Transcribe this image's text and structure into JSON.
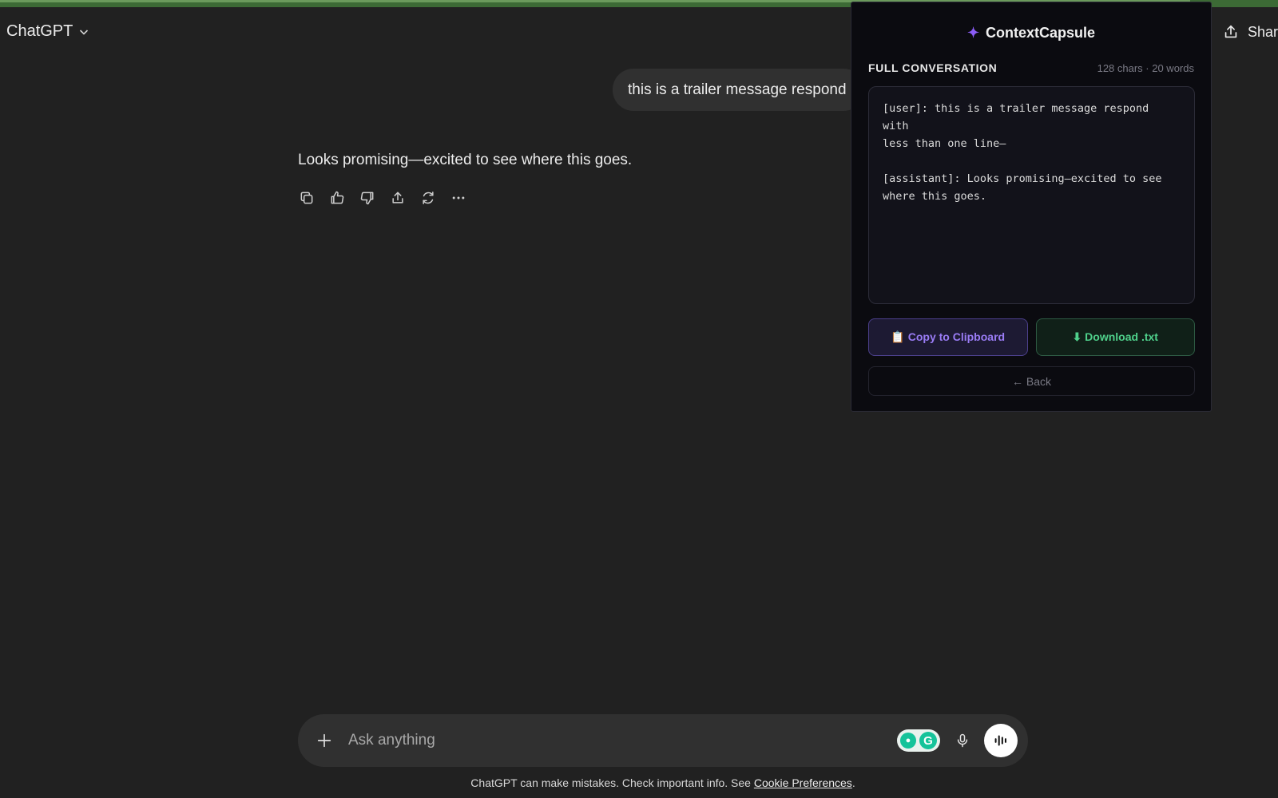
{
  "header": {
    "model_label": "ChatGPT",
    "share_label": "Share"
  },
  "conversation": {
    "user_message": "this is a trailer message respond",
    "assistant_message": "Looks promising—excited to see where this goes."
  },
  "capsule": {
    "title": "ContextCapsule",
    "section_label": "FULL CONVERSATION",
    "stats": "128 chars · 20 words",
    "transcript": "[user]: this is a trailer message respond with\nless than one line—\n\n[assistant]: Looks promising—excited to see\nwhere this goes.",
    "copy_label": "📋 Copy to Clipboard",
    "download_label": "⬇ Download .txt",
    "back_label": "← Back",
    "colors": {
      "accent_purple": "#8b5cf6",
      "accent_green": "#4fd18b"
    }
  },
  "composer": {
    "placeholder": "Ask anything"
  },
  "footer": {
    "disclaimer_text": "ChatGPT can make mistakes. Check important info. See ",
    "link_text": "Cookie Preferences",
    "suffix": "."
  }
}
